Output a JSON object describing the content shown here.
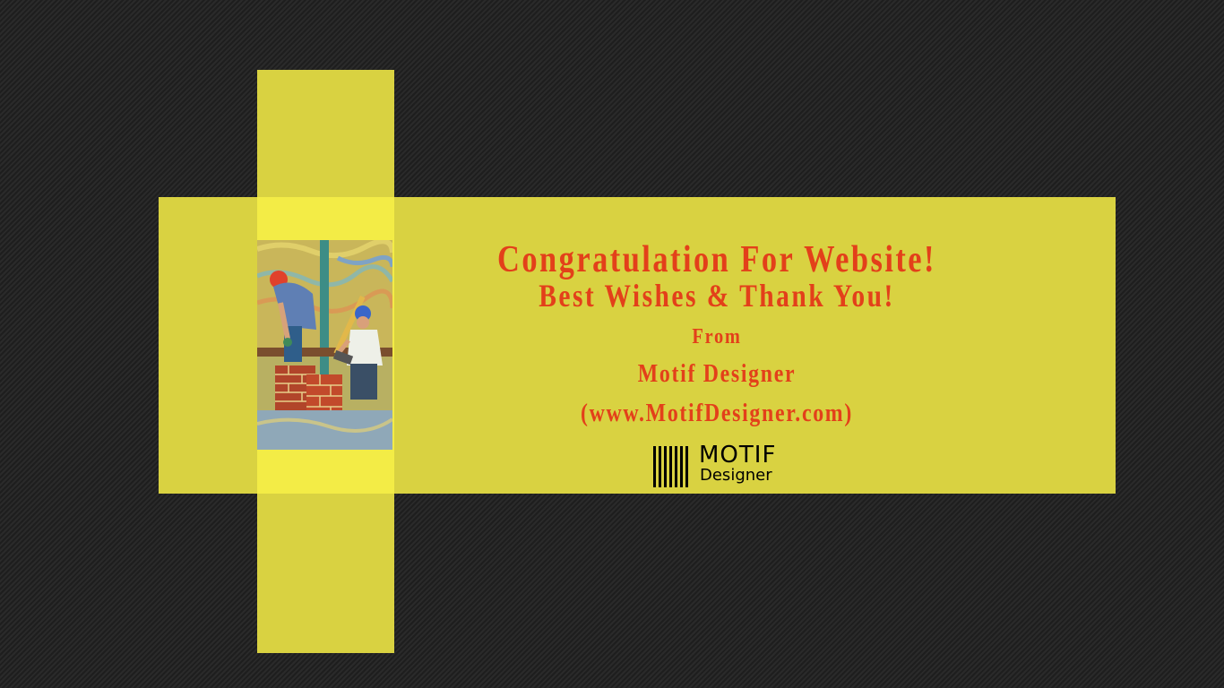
{
  "card": {
    "headline": "Congratulation For Website!",
    "subheadline": "Best Wishes & Thank You!",
    "from_label": "From",
    "company_name": "Motif Designer",
    "company_url": "(www.MotifDesigner.com)"
  },
  "logo": {
    "word": "MOTIF",
    "subword": "Designer"
  },
  "artwork": {
    "subject": "construction-workers-laying-bricks-illustration"
  },
  "colors": {
    "background": "#232323",
    "band": "#d9d241",
    "band_overlap": "#f3ec46",
    "text_accent": "#e3401a",
    "logo": "#000000"
  }
}
